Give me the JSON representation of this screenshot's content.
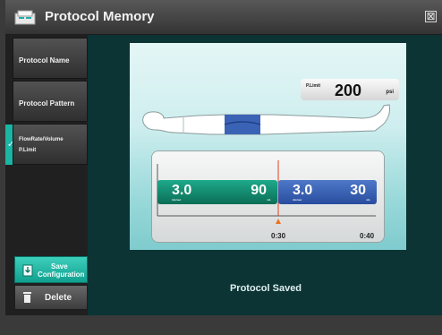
{
  "window": {
    "title": "Protocol Memory",
    "close_label": "⊠"
  },
  "sidebar": {
    "items": [
      {
        "label": "Protocol Name"
      },
      {
        "label": "Protocol Pattern"
      },
      {
        "line1": "FlowRate/Volume",
        "line2": "P.Limit",
        "active": true
      }
    ],
    "save_label_1": "Save",
    "save_label_2": "Configuration",
    "delete_label": "Delete"
  },
  "diagram": {
    "plimit_label": "P.Limit",
    "plimit_value": "200",
    "plimit_unit": "psi",
    "phases": [
      {
        "rate": "3.0",
        "rate_unit": "mL/sec",
        "volume": "90",
        "volume_unit": "mL",
        "color": "#137f66"
      },
      {
        "rate": "3.0",
        "rate_unit": "mL/sec",
        "volume": "30",
        "volume_unit": "mL",
        "color": "#3a64b8"
      }
    ],
    "time_marks": [
      "0:30",
      "0:40"
    ]
  },
  "status": {
    "message": "Protocol Saved"
  },
  "colors": {
    "accent": "#1bb5a4",
    "background": "#0c3434"
  }
}
